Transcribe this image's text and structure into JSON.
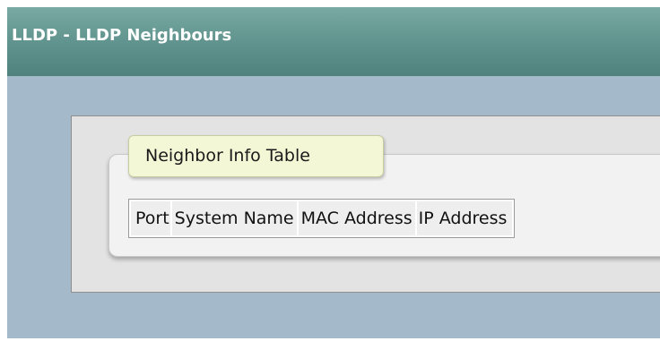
{
  "page": {
    "title": "LLDP - LLDP Neighbours"
  },
  "neighbor_section": {
    "legend": "Neighbor Info Table",
    "columns": [
      "Port",
      "System Name",
      "MAC Address",
      "IP Address"
    ],
    "rows": []
  },
  "colors": {
    "title_bar": "#5f928c",
    "title_text": "#ffffff",
    "content_background": "#a4b9c9",
    "panel_background": "#e3e3e3",
    "legend_background": "#f4f7d6",
    "header_cell_background": "#eeeeee"
  }
}
